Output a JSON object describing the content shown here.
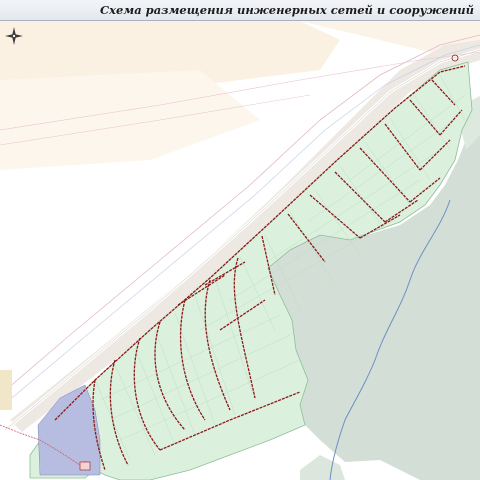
{
  "title": "Схема размещения инженерных сетей и сооружений",
  "icons": {
    "north_arrow": "compass-north-arrow-icon"
  },
  "colors": {
    "background": "#ffffff",
    "title_bar": "#e8ecf1",
    "beige_zone": "#fbf1e2",
    "lot_fill": "#dcf0de",
    "lot_edge": "#8cbf95",
    "forest": "#d3dfd6",
    "network_line": "#8b1a1a",
    "water_line": "#6b8fc4",
    "highway_band": "#ede9e2",
    "plaza": "#b7bde0"
  }
}
